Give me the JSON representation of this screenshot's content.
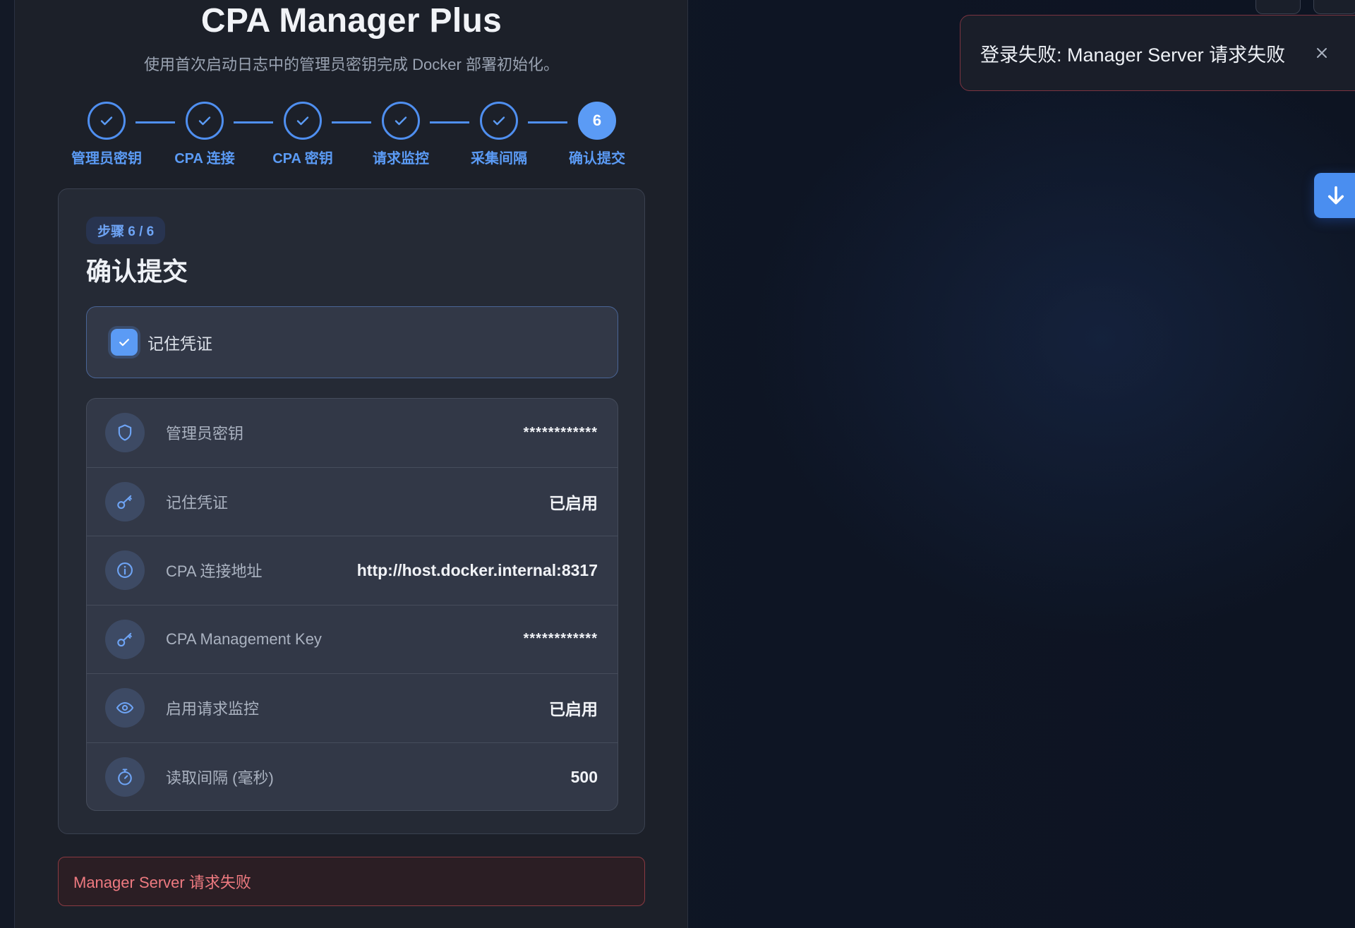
{
  "header": {
    "title": "CPA Manager Plus",
    "subtitle": "使用首次启动日志中的管理员密钥完成 Docker 部署初始化。"
  },
  "stepper": {
    "steps": [
      {
        "label": "管理员密钥",
        "status": "done",
        "icon": "check-icon"
      },
      {
        "label": "CPA 连接",
        "status": "done",
        "icon": "check-icon"
      },
      {
        "label": "CPA 密钥",
        "status": "done",
        "icon": "check-icon"
      },
      {
        "label": "请求监控",
        "status": "done",
        "icon": "check-icon"
      },
      {
        "label": "采集间隔",
        "status": "done",
        "icon": "check-icon"
      },
      {
        "label": "确认提交",
        "status": "active",
        "number": "6"
      }
    ]
  },
  "card": {
    "badge": "步骤 6 / 6",
    "title": "确认提交",
    "remember": {
      "label": "记住凭证",
      "checked": true
    },
    "summary": [
      {
        "icon": "shield-icon",
        "label": "管理员密钥",
        "value": "************"
      },
      {
        "icon": "key-icon",
        "label": "记住凭证",
        "value": "已启用"
      },
      {
        "icon": "info-icon",
        "label": "CPA 连接地址",
        "value": "http://host.docker.internal:8317"
      },
      {
        "icon": "key-icon",
        "label": "CPA Management Key",
        "value": "************"
      },
      {
        "icon": "eye-icon",
        "label": "启用请求监控",
        "value": "已启用"
      },
      {
        "icon": "stopwatch-icon",
        "label": "读取间隔 (毫秒)",
        "value": "500"
      }
    ]
  },
  "error": {
    "message": "Manager Server 请求失败"
  },
  "toast": {
    "message": "登录失败: Manager Server 请求失败",
    "icon": "close-icon"
  },
  "fab": {
    "icon": "arrow-down-icon"
  },
  "colors": {
    "accent": "#5b9bf5",
    "panel": "#1c2029",
    "card": "#252a35",
    "error": "#ee7a80",
    "error_border": "#8a3a42"
  }
}
